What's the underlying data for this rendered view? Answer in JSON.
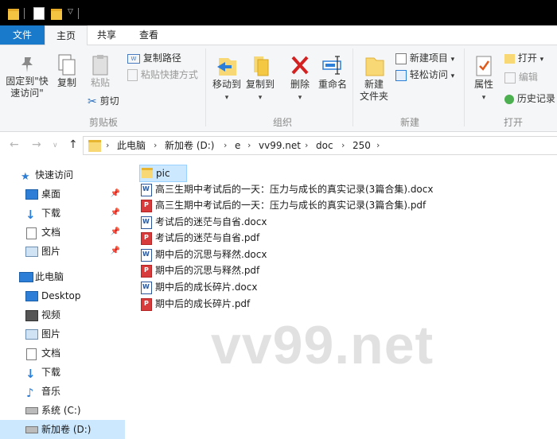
{
  "ribbon_tabs": {
    "file": "文件",
    "home": "主页",
    "share": "共享",
    "view": "查看"
  },
  "clipboard": {
    "pin_line1": "固定到\"快",
    "pin_line2": "速访问\"",
    "copy": "复制",
    "paste": "粘贴",
    "copy_path": "复制路径",
    "paste_shortcut": "粘贴快捷方式",
    "cut": "剪切",
    "group_label": "剪贴板"
  },
  "organize": {
    "move_to": "移动到",
    "copy_to": "复制到",
    "delete": "删除",
    "rename": "重命名",
    "group_label": "组织"
  },
  "new_group": {
    "new_folder_line1": "新建",
    "new_folder_line2": "文件夹",
    "new_item": "新建项目",
    "easy_access": "轻松访问",
    "group_label": "新建"
  },
  "open_group": {
    "properties": "属性",
    "open": "打开",
    "edit": "编辑",
    "history": "历史记录",
    "group_label": "打开"
  },
  "breadcrumb": [
    "此电脑",
    "新加卷 (D:)",
    "e",
    "vv99.net",
    "doc",
    "250"
  ],
  "nav_pane": {
    "quick_access": "快速访问",
    "quick_items": [
      "桌面",
      "下载",
      "文档",
      "图片"
    ],
    "this_pc": "此电脑",
    "pc_items": [
      "Desktop",
      "视频",
      "图片",
      "文档",
      "下载",
      "音乐",
      "系统 (C:)",
      "新加卷 (D:)"
    ]
  },
  "files": [
    {
      "name": "pic",
      "type": "folder"
    },
    {
      "name": "高三生期中考试后的一天：压力与成长的真实记录(3篇合集).docx",
      "type": "docx"
    },
    {
      "name": "高三生期中考试后的一天：压力与成长的真实记录(3篇合集).pdf",
      "type": "pdf"
    },
    {
      "name": "考试后的迷茫与自省.docx",
      "type": "docx"
    },
    {
      "name": "考试后的迷茫与自省.pdf",
      "type": "pdf"
    },
    {
      "name": "期中后的沉思与释然.docx",
      "type": "docx"
    },
    {
      "name": "期中后的沉思与释然.pdf",
      "type": "pdf"
    },
    {
      "name": "期中后的成长碎片.docx",
      "type": "docx"
    },
    {
      "name": "期中后的成长碎片.pdf",
      "type": "pdf"
    }
  ],
  "watermark": "vv99.net",
  "colors": {
    "file_tab": "#1979ca",
    "selection": "#cce8ff",
    "folder": "#f8d775"
  }
}
